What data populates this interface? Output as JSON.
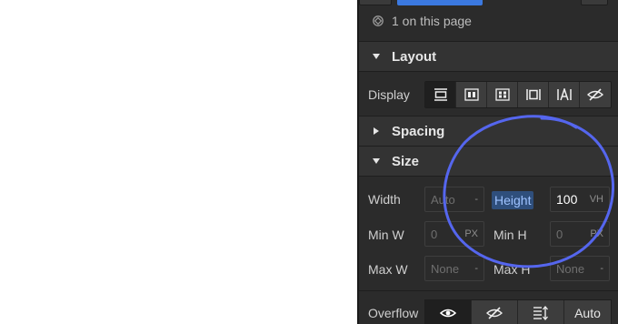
{
  "usage": {
    "text": "1 on this page",
    "icon": "selector-icon"
  },
  "sections": {
    "layout": {
      "title": "Layout",
      "expanded": true
    },
    "spacing": {
      "title": "Spacing",
      "expanded": false
    },
    "size": {
      "title": "Size",
      "expanded": true
    }
  },
  "display": {
    "label": "Display",
    "options": [
      "block",
      "flex",
      "grid",
      "inline-block",
      "inline",
      "none"
    ],
    "selected": "block"
  },
  "size": {
    "width": {
      "label": "Width",
      "value": "Auto",
      "unit": "-"
    },
    "height": {
      "label": "Height",
      "value": "100",
      "unit": "VH"
    },
    "min_w": {
      "label": "Min W",
      "value": "0",
      "unit": "PX"
    },
    "min_h": {
      "label": "Min H",
      "value": "0",
      "unit": "PX"
    },
    "max_w": {
      "label": "Max W",
      "value": "None",
      "unit": "-"
    },
    "max_h": {
      "label": "Max H",
      "value": "None",
      "unit": "-"
    }
  },
  "overflow": {
    "label": "Overflow",
    "options": [
      "visible",
      "hidden",
      "scroll",
      "Auto"
    ],
    "auto_label": "Auto",
    "selected": "visible"
  },
  "colors": {
    "panel": "#2b2b2b",
    "accent": "#3b79e0",
    "annotation": "#5566ee",
    "height_chip": "#2f4f7c"
  }
}
